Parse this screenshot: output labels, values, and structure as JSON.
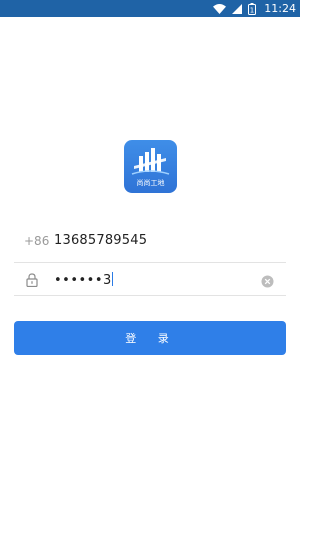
{
  "status_bar": {
    "time": "11:24",
    "battery_level": "1",
    "icons": [
      "wifi-icon",
      "signal-icon",
      "battery-icon"
    ]
  },
  "logo": {
    "text": "尚尚工地"
  },
  "phone": {
    "prefix": "+86",
    "value": "13685789545"
  },
  "password": {
    "value": "••••••3",
    "icons": [
      "lock-icon",
      "clear-icon"
    ]
  },
  "login_button": {
    "label": "登 录"
  },
  "colors": {
    "status_bar": "#1f63a6",
    "primary": "#2f7fe8",
    "logo_bg": "#3f8ee8"
  }
}
